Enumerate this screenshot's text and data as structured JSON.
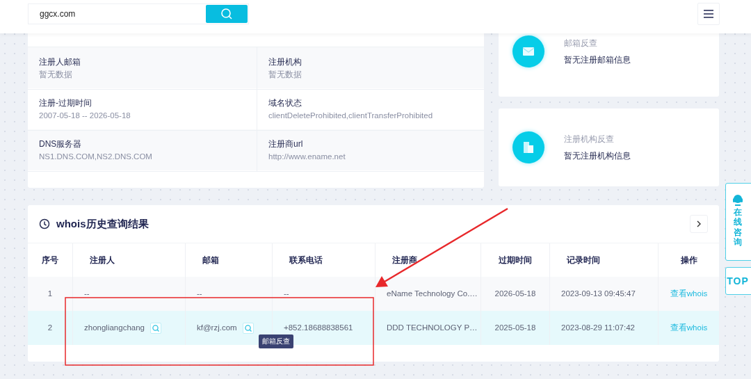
{
  "search": {
    "value": "ggcx.com"
  },
  "info_rows": [
    [
      {
        "label": "注册人邮箱",
        "value": "暂无数据"
      },
      {
        "label": "注册机构",
        "value": "暂无数据"
      }
    ],
    [
      {
        "label": "注册-过期时间",
        "value": "2007-05-18 -- 2026-05-18"
      },
      {
        "label": "域名状态",
        "value": "clientDeleteProhibited,clientTransferProhibited"
      }
    ],
    [
      {
        "label": "DNS服务器",
        "value": "NS1.DNS.COM,NS2.DNS.COM"
      },
      {
        "label": "注册商url",
        "value": "http://www.ename.net"
      }
    ]
  ],
  "reverse_cards": [
    {
      "kind": "email",
      "title": "邮箱反查",
      "text": "暂无注册邮箱信息"
    },
    {
      "kind": "org",
      "title": "注册机构反查",
      "text": "暂无注册机构信息"
    }
  ],
  "history": {
    "title": "whois历史查询结果",
    "columns": [
      "序号",
      "注册人",
      "邮箱",
      "联系电话",
      "注册商",
      "过期时间",
      "记录时间",
      "操作"
    ],
    "rows": [
      {
        "selected": false,
        "cells": [
          {
            "text": "1"
          },
          {
            "text": "--"
          },
          {
            "text": "--"
          },
          {
            "text": "--"
          },
          {
            "text": "eName Technology Co.…"
          },
          {
            "text": "2026-05-18"
          },
          {
            "text": "2023-09-13 09:45:47"
          },
          {
            "text": "查看whois",
            "kind": "link"
          }
        ]
      },
      {
        "selected": true,
        "cells": [
          {
            "text": "2"
          },
          {
            "text": "zhongliangchang",
            "search_button": true
          },
          {
            "text": "kf@rzj.com",
            "search_button": true
          },
          {
            "text": "+852.18688838561"
          },
          {
            "text": "DDD TECHNOLOGY P…"
          },
          {
            "text": "2025-05-18"
          },
          {
            "text": "2023-08-29 11:07:42"
          },
          {
            "text": "查看whois",
            "kind": "link"
          }
        ]
      }
    ]
  },
  "tooltip": {
    "text": "邮箱反查"
  },
  "side_buttons": [
    {
      "kind": "consult",
      "text": "在线咨询"
    },
    {
      "kind": "top",
      "text": "TOP"
    }
  ]
}
